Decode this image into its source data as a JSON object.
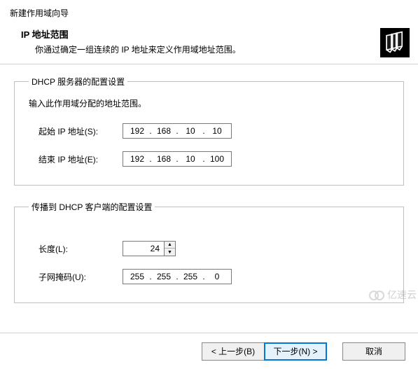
{
  "header": {
    "wizard_title": "新建作用域向导",
    "subtitle": "IP 地址范围",
    "subtitle_desc": "你通过确定一组连续的 IP 地址来定义作用域地址范围。"
  },
  "group_server": {
    "legend": "DHCP 服务器的配置设置",
    "instruction": "输入此作用域分配的地址范围。",
    "start_label": "起始 IP 地址(S):",
    "start_ip": {
      "o1": "192",
      "o2": "168",
      "o3": "10",
      "o4": "10"
    },
    "end_label": "结束 IP 地址(E):",
    "end_ip": {
      "o1": "192",
      "o2": "168",
      "o3": "10",
      "o4": "100"
    }
  },
  "group_client": {
    "legend": "传播到 DHCP 客户端的配置设置",
    "length_label": "长度(L):",
    "length_value": "24",
    "mask_label": "子网掩码(U):",
    "mask": {
      "o1": "255",
      "o2": "255",
      "o3": "255",
      "o4": "0"
    }
  },
  "buttons": {
    "back": "< 上一步(B)",
    "next": "下一步(N) >",
    "cancel": "取消"
  },
  "watermark": "亿速云",
  "dot": "."
}
